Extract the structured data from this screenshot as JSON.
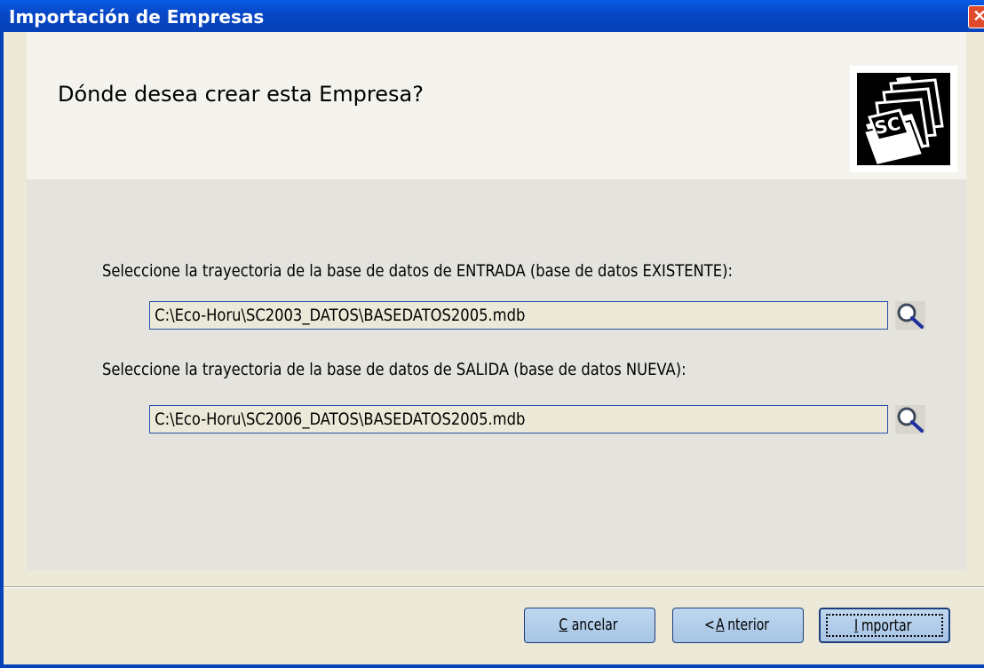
{
  "window": {
    "title": "Importación de Empresas",
    "close_label": "✕"
  },
  "header": {
    "heading": "Dónde desea crear esta Empresa?",
    "logo_text": "SC"
  },
  "input_db": {
    "label": "Seleccione la trayectoria de la base de datos de ENTRADA (base de datos EXISTENTE):",
    "value": "C:\\Eco-Horu\\SC2003_DATOS\\BASEDATOS2005.mdb"
  },
  "output_db": {
    "label": "Seleccione la trayectoria de la base de datos de SALIDA (base de datos NUEVA):",
    "value": "C:\\Eco-Horu\\SC2006_DATOS\\BASEDATOS2005.mdb"
  },
  "buttons": {
    "cancel": {
      "mnemonic": "C",
      "rest": "ancelar"
    },
    "back": {
      "prefix": "< ",
      "mnemonic": "A",
      "rest": "nterior"
    },
    "import": {
      "mnemonic": "I",
      "rest": "mportar"
    }
  },
  "colors": {
    "titlebar": "#0746C6",
    "button": "#A6C4E4",
    "field_border": "#2A4FA8"
  }
}
